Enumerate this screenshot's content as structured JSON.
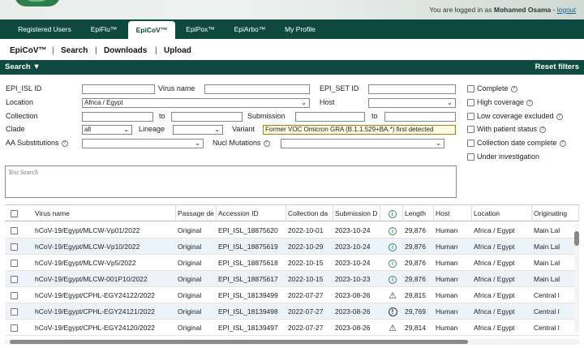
{
  "header": {
    "logged_prefix": "You are logged in as ",
    "user_name": "Mohamed Osama",
    "sep": " - ",
    "logout": "logout"
  },
  "tabs": [
    "Registered Users",
    "EpiFlu™",
    "EpiCoV™",
    "EpiPox™",
    "EpiArbo™",
    "My Profile"
  ],
  "active_tab": "EpiCoV™",
  "subnav": {
    "home": "EpiCoV™",
    "search": "Search",
    "downloads": "Downloads",
    "upload": "Upload",
    "sep": "|"
  },
  "searchbar": {
    "title": "Search ▼",
    "reset": "Reset filters"
  },
  "filters": {
    "epi_isl_label": "EPI_ISL ID",
    "virus_name_label": "Virus name",
    "epi_set_label": "EPI_SET ID",
    "location_label": "Location",
    "location_value": "Africa / Egypt",
    "host_label": "Host",
    "collection_label": "Collection",
    "to_label": "to",
    "submission_label": "Submission",
    "clade_label": "Clade",
    "clade_value": "all",
    "lineage_label": "Lineage",
    "variant_label": "Variant",
    "variant_value": "Former VOC Omicron GRA (B.1.1.529+BA.*) first detected",
    "aa_label": "AA Substitutions",
    "nucl_label": "Nucl Mutations",
    "text_search_placeholder": "Text Search"
  },
  "checkboxes": [
    "Complete",
    "High coverage",
    "Low coverage excluded",
    "With patient status",
    "Collection date complete",
    "Under investigation"
  ],
  "icons": {
    "help": "?",
    "info": "i",
    "warn_triangle": "⚠",
    "warn_circle": "!",
    "chevron": "⌄"
  },
  "table": {
    "columns": [
      "Virus name",
      "Passage de",
      "Accession ID",
      "Collection da",
      "Submission D",
      "",
      "Length",
      "Host",
      "Location",
      "Originating"
    ],
    "rows": [
      {
        "virus": "hCoV-19/Egypt/MLCW-Vp01/2022",
        "passage": "Original",
        "acc": "EPI_ISL_18875620",
        "coll": "2022-10-01",
        "sub": "2023-10-24",
        "flag": "info",
        "len": "29,876",
        "host": "Human",
        "loc": "Africa / Egypt",
        "orig": "Main Lal"
      },
      {
        "virus": "hCoV-19/Egypt/MLCW-Vp10/2022",
        "passage": "Original",
        "acc": "EPI_ISL_18875619",
        "coll": "2022-10-29",
        "sub": "2023-10-24",
        "flag": "info",
        "len": "29,876",
        "host": "Human",
        "loc": "Africa / Egypt",
        "orig": "Main Lal"
      },
      {
        "virus": "hCoV-19/Egypt/MLCW-Vp5/2022",
        "passage": "Original",
        "acc": "EPI_ISL_18875618",
        "coll": "2022-10-15",
        "sub": "2023-10-24",
        "flag": "info",
        "len": "29,876",
        "host": "Human",
        "loc": "Africa / Egypt",
        "orig": "Main Lal"
      },
      {
        "virus": "hCoV-19/Egypt/MLCW-001P10/2022",
        "passage": "Original",
        "acc": "EPI_ISL_18875617",
        "coll": "2022-10-15",
        "sub": "2023-10-23",
        "flag": "info",
        "len": "29,876",
        "host": "Human",
        "loc": "Africa / Egypt",
        "orig": "Main Lal"
      },
      {
        "virus": "hCoV-19/Egypt/CPHL-EGY24122/2022",
        "passage": "Original",
        "acc": "EPI_ISL_18139499",
        "coll": "2022-07-27",
        "sub": "2023-08-26",
        "flag": "warn_triangle",
        "len": "29,815",
        "host": "Human",
        "loc": "Africa / Egypt",
        "orig": "Central l"
      },
      {
        "virus": "hCoV-19/Egypt/CPHL-EGY24121/2022",
        "passage": "Original",
        "acc": "EPI_ISL_18139498",
        "coll": "2022-07-27",
        "sub": "2023-08-26",
        "flag": "warn_circle",
        "len": "29,769",
        "host": "Human",
        "loc": "Africa / Egypt",
        "orig": "Central l"
      },
      {
        "virus": "hCoV-19/Egypt/CPHL-EGY24120/2022",
        "passage": "Original",
        "acc": "EPI_ISL_18139497",
        "coll": "2022-07-27",
        "sub": "2023-08-26",
        "flag": "warn_triangle",
        "len": "29,814",
        "host": "Human",
        "loc": "Africa / Egypt",
        "orig": "Central l"
      }
    ]
  }
}
